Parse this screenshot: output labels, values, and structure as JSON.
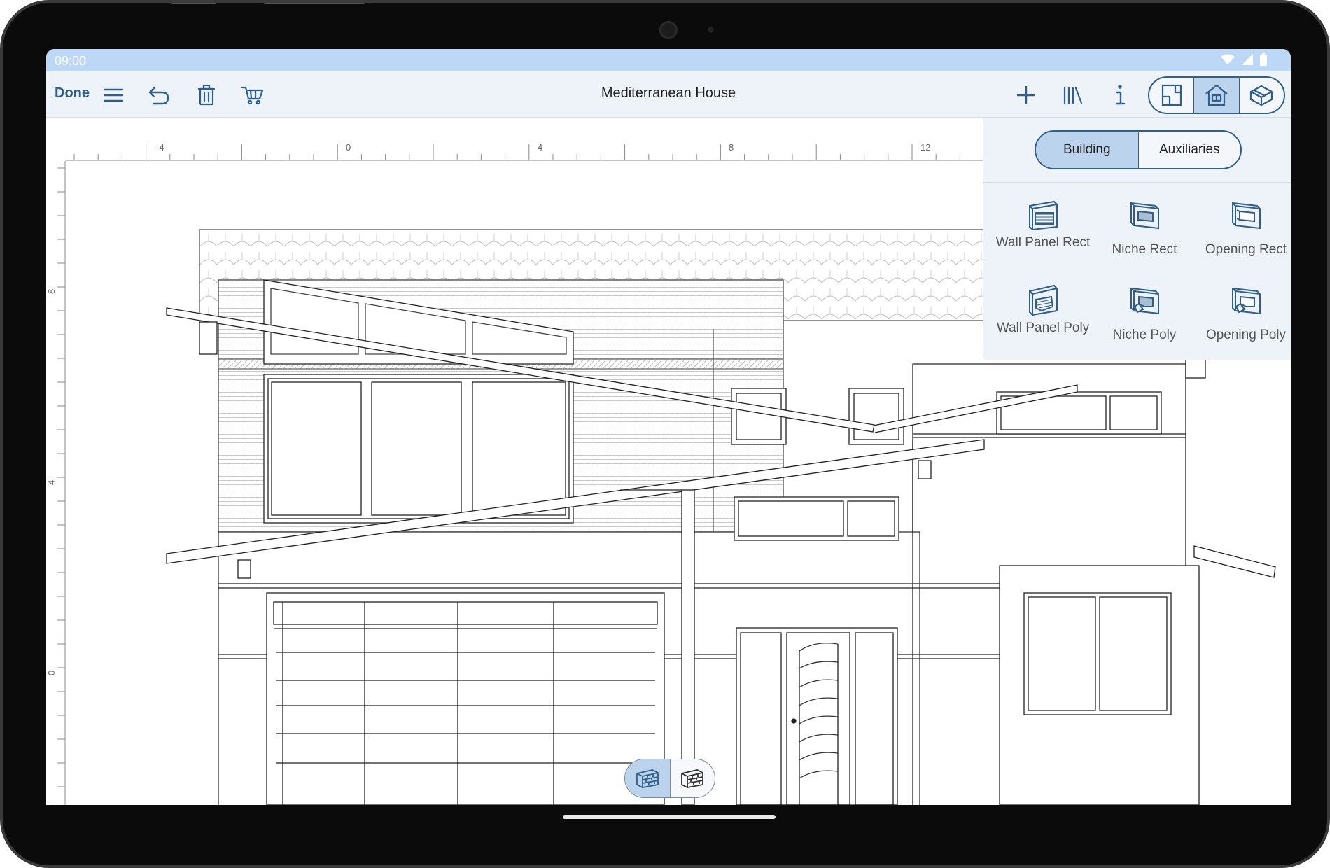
{
  "status_bar": {
    "time": "09:00"
  },
  "toolbar": {
    "done_label": "Done",
    "title": "Mediterranean House"
  },
  "ruler": {
    "unit": "m",
    "top_labels": [
      "-4",
      "0",
      "4",
      "8",
      "12"
    ],
    "left_labels": [
      "8",
      "4",
      "0"
    ]
  },
  "panel": {
    "tabs": [
      "Building",
      "Auxiliaries"
    ],
    "active_tab": "Building",
    "tools": [
      {
        "label": "Wall Panel Rect",
        "icon": "wall-panel-rect-icon"
      },
      {
        "label": "Niche Rect",
        "icon": "niche-rect-icon"
      },
      {
        "label": "Opening Rect",
        "icon": "opening-rect-icon"
      },
      {
        "label": "Wall Panel Poly",
        "icon": "wall-panel-poly-icon"
      },
      {
        "label": "Niche Poly",
        "icon": "niche-poly-icon"
      },
      {
        "label": "Opening Poly",
        "icon": "opening-poly-icon"
      }
    ]
  },
  "colors": {
    "accent": "#2f5f8a",
    "selected": "#bcd3ee",
    "toolbar_bg": "#eef3fa",
    "status_bar": "#bcd8f6"
  }
}
